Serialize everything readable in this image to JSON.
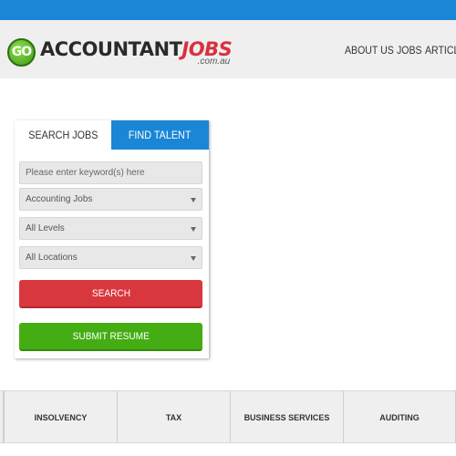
{
  "header": {
    "logo": {
      "badge": "GO",
      "main_a": "ACCOUNTANT",
      "main_b": "JOBS",
      "sub": ".com.au"
    },
    "nav": [
      "ABOUT US",
      "JOBS",
      "ARTICLES"
    ]
  },
  "search_panel": {
    "tabs": [
      {
        "label": "SEARCH JOBS",
        "active": true
      },
      {
        "label": "FIND TALENT",
        "active": false
      }
    ],
    "keyword_placeholder": "Please enter keyword(s) here",
    "category_select": "Accounting Jobs",
    "level_select": "All Levels",
    "location_select": "All Locations",
    "search_button": "SEARCH",
    "submit_button": "SUBMIT RESUME"
  },
  "categories": [
    "INSOLVENCY",
    "TAX",
    "BUSINESS SERVICES",
    "AUDITING"
  ],
  "colors": {
    "brand_blue": "#1a86d6",
    "search_red": "#d9373e",
    "submit_green": "#45ad14",
    "jobs_red": "#d9313c"
  }
}
